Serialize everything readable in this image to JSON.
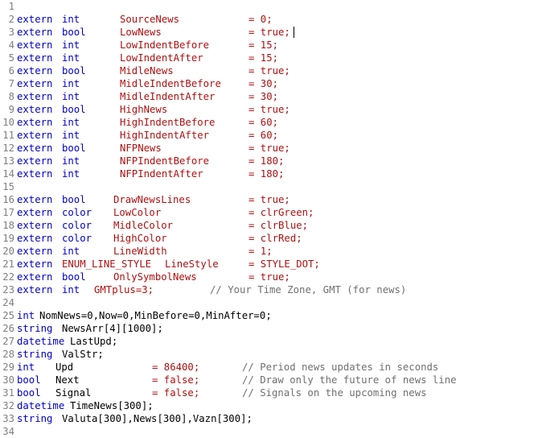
{
  "editor": {
    "line_numbers": [
      "1",
      "2",
      "3",
      "4",
      "5",
      "6",
      "7",
      "8",
      "9",
      "10",
      "11",
      "12",
      "13",
      "14",
      "15",
      "16",
      "17",
      "18",
      "19",
      "20",
      "21",
      "22",
      "23",
      "24",
      "25",
      "26",
      "27",
      "28",
      "29",
      "30",
      "31",
      "32",
      "33",
      "34"
    ],
    "lines": [
      [],
      [
        {
          "t": "extern",
          "c": "kw"
        },
        {
          "t": "int",
          "c": "ty"
        },
        {
          "t": "SourceNews",
          "c": "id"
        },
        {
          "t": "= 0;",
          "c": "nm"
        }
      ],
      [
        {
          "t": "extern",
          "c": "kw"
        },
        {
          "t": "bool",
          "c": "ty"
        },
        {
          "t": "LowNews",
          "c": "id"
        },
        {
          "t": "= true;",
          "c": "nm"
        }
      ],
      [
        {
          "t": "extern",
          "c": "kw"
        },
        {
          "t": "int",
          "c": "ty"
        },
        {
          "t": "LowIndentBefore",
          "c": "id"
        },
        {
          "t": "= 15;",
          "c": "nm"
        }
      ],
      [
        {
          "t": "extern",
          "c": "kw"
        },
        {
          "t": "int",
          "c": "ty"
        },
        {
          "t": "LowIndentAfter",
          "c": "id"
        },
        {
          "t": "= 15;",
          "c": "nm"
        }
      ],
      [
        {
          "t": "extern",
          "c": "kw"
        },
        {
          "t": "bool",
          "c": "ty"
        },
        {
          "t": "MidleNews",
          "c": "id"
        },
        {
          "t": "= true;",
          "c": "nm"
        }
      ],
      [
        {
          "t": "extern",
          "c": "kw"
        },
        {
          "t": "int",
          "c": "ty"
        },
        {
          "t": "MidleIndentBefore",
          "c": "id"
        },
        {
          "t": "= 30;",
          "c": "nm"
        }
      ],
      [
        {
          "t": "extern",
          "c": "kw"
        },
        {
          "t": "int",
          "c": "ty"
        },
        {
          "t": "MidleIndentAfter",
          "c": "id"
        },
        {
          "t": "= 30;",
          "c": "nm"
        }
      ],
      [
        {
          "t": "extern",
          "c": "kw"
        },
        {
          "t": "bool",
          "c": "ty"
        },
        {
          "t": "HighNews",
          "c": "id"
        },
        {
          "t": "= true;",
          "c": "nm"
        }
      ],
      [
        {
          "t": "extern",
          "c": "kw"
        },
        {
          "t": "int",
          "c": "ty"
        },
        {
          "t": "HighIndentBefore",
          "c": "id"
        },
        {
          "t": "= 60;",
          "c": "nm"
        }
      ],
      [
        {
          "t": "extern",
          "c": "kw"
        },
        {
          "t": "int",
          "c": "ty"
        },
        {
          "t": "HighIndentAfter",
          "c": "id"
        },
        {
          "t": "= 60;",
          "c": "nm"
        }
      ],
      [
        {
          "t": "extern",
          "c": "kw"
        },
        {
          "t": "bool",
          "c": "ty"
        },
        {
          "t": "NFPNews",
          "c": "id"
        },
        {
          "t": "= true;",
          "c": "nm"
        }
      ],
      [
        {
          "t": "extern",
          "c": "kw"
        },
        {
          "t": "int",
          "c": "ty"
        },
        {
          "t": "NFPIndentBefore",
          "c": "id"
        },
        {
          "t": "= 180;",
          "c": "nm"
        }
      ],
      [
        {
          "t": "extern",
          "c": "kw"
        },
        {
          "t": "int",
          "c": "ty"
        },
        {
          "t": "NFPIndentAfter",
          "c": "id"
        },
        {
          "t": "= 180;",
          "c": "nm"
        }
      ],
      [],
      [
        {
          "t": "extern",
          "c": "kw"
        },
        {
          "t": "bool",
          "c": "ty"
        },
        {
          "t": "DrawNewsLines",
          "c": "id"
        },
        {
          "t": "= true;",
          "c": "nm"
        }
      ],
      [
        {
          "t": "extern",
          "c": "kw"
        },
        {
          "t": "color",
          "c": "ty"
        },
        {
          "t": "LowColor",
          "c": "id"
        },
        {
          "t": "= clrGreen;",
          "c": "nm"
        }
      ],
      [
        {
          "t": "extern",
          "c": "kw"
        },
        {
          "t": "color",
          "c": "ty"
        },
        {
          "t": "MidleColor",
          "c": "id"
        },
        {
          "t": "= clrBlue;",
          "c": "nm"
        }
      ],
      [
        {
          "t": "extern",
          "c": "kw"
        },
        {
          "t": "color",
          "c": "ty"
        },
        {
          "t": "HighColor",
          "c": "id"
        },
        {
          "t": "= clrRed;",
          "c": "nm"
        }
      ],
      [
        {
          "t": "extern",
          "c": "kw"
        },
        {
          "t": "int",
          "c": "ty"
        },
        {
          "t": "LineWidth",
          "c": "id"
        },
        {
          "t": "= 1;",
          "c": "nm"
        }
      ],
      [
        {
          "t": "extern",
          "c": "kw"
        },
        {
          "t": "ENUM_LINE_STYLE",
          "c": "id"
        },
        {
          "t": "LineStyle",
          "c": "id"
        },
        {
          "t": "= STYLE_DOT;",
          "c": "nm"
        }
      ],
      [
        {
          "t": "extern",
          "c": "kw"
        },
        {
          "t": "bool",
          "c": "ty"
        },
        {
          "t": "OnlySymbolNews",
          "c": "id"
        },
        {
          "t": "= true;",
          "c": "nm"
        }
      ],
      [
        {
          "t": "extern",
          "c": "kw"
        },
        {
          "t": "int",
          "c": "ty"
        },
        {
          "t": "GMTplus=3;",
          "c": "id"
        },
        {
          "t": "// Your Time Zone, GMT (for news)",
          "c": "cm"
        }
      ],
      [],
      [
        {
          "t": "int",
          "c": "ty"
        },
        {
          "t": "NomNews=0,Now=0,MinBefore=0,MinAfter=0;",
          "c": "pl"
        }
      ],
      [
        {
          "t": "string",
          "c": "ty"
        },
        {
          "t": "NewsArr[4][1000];",
          "c": "pl"
        }
      ],
      [
        {
          "t": "datetime",
          "c": "ty"
        },
        {
          "t": "LastUpd;",
          "c": "pl"
        }
      ],
      [
        {
          "t": "string",
          "c": "ty"
        },
        {
          "t": "ValStr;",
          "c": "pl"
        }
      ],
      [
        {
          "t": "int",
          "c": "ty"
        },
        {
          "t": "Upd",
          "c": "pl"
        },
        {
          "t": "= 86400;",
          "c": "nm"
        },
        {
          "t": "// Period news updates in seconds",
          "c": "cm"
        }
      ],
      [
        {
          "t": "bool",
          "c": "ty"
        },
        {
          "t": "Next",
          "c": "pl"
        },
        {
          "t": "= false;",
          "c": "nm"
        },
        {
          "t": "// Draw only the future of news line",
          "c": "cm"
        }
      ],
      [
        {
          "t": "bool",
          "c": "ty"
        },
        {
          "t": "Signal",
          "c": "pl"
        },
        {
          "t": "= false;",
          "c": "nm"
        },
        {
          "t": "// Signals on the upcoming news",
          "c": "cm"
        }
      ],
      [
        {
          "t": "datetime",
          "c": "ty"
        },
        {
          "t": "TimeNews[300];",
          "c": "pl"
        }
      ],
      [
        {
          "t": "string",
          "c": "ty"
        },
        {
          "t": "Valuta[300],News[300],Vazn[300];",
          "c": "pl"
        }
      ],
      []
    ]
  }
}
